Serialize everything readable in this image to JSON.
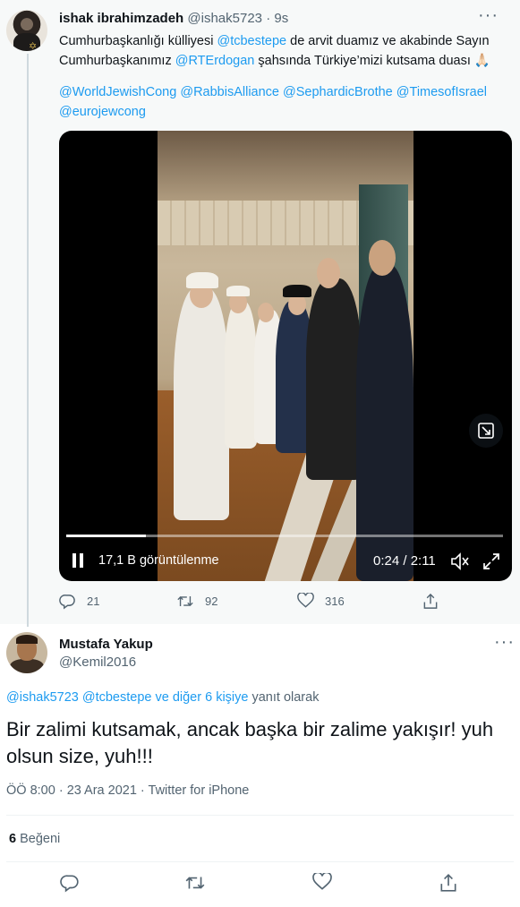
{
  "parent_tweet": {
    "author_name": "ishak ibrahimzadeh",
    "author_handle": "@ishak5723",
    "time": "9s",
    "text_parts": [
      "Cumhurbaşkanlığı külliyesi ",
      "@tcbestepe",
      " de arvit duamız ve akabinde Sayın Cumhurbaşkanımız ",
      "@RTErdogan",
      " şahsında Türkiye’mizi kutsama duası 🙏🏻"
    ],
    "tags": [
      "@WorldJewishCong",
      "@RabbisAlliance",
      "@SephardicBrothe",
      "@TimesofIsrael",
      "@eurojewcong"
    ],
    "video": {
      "views": "17,1 B görüntülenme",
      "time": "0:24 / 2:11",
      "progress": 0.183
    },
    "actions": {
      "reply_count": "21",
      "retweet_count": "92",
      "like_count": "316"
    }
  },
  "main_tweet": {
    "author_name": "Mustafa Yakup",
    "author_handle": "@Kemil2016",
    "reply_to": {
      "mentions": "@ishak5723 @tcbestepe",
      "others": " ve diğer 6 kişiye",
      "suffix": " yanıt olarak"
    },
    "text": "Bir zalimi kutsamak, ancak başka bir zalime yakışır! yuh olsun size, yuh!!!",
    "timestamp": "ÖÖ 8:00 · 23 Ara 2021 · Twitter for iPhone",
    "likes_count": "6",
    "likes_label": "Beğeni"
  },
  "colors": {
    "link": "#1d9bf0",
    "muted": "#536471",
    "parent_bg": "#f7f9f9"
  },
  "icons": [
    "reply-icon",
    "retweet-icon",
    "like-icon",
    "share-icon",
    "more-icon",
    "pause-icon",
    "mute-icon",
    "fullscreen-icon",
    "pip-icon"
  ]
}
